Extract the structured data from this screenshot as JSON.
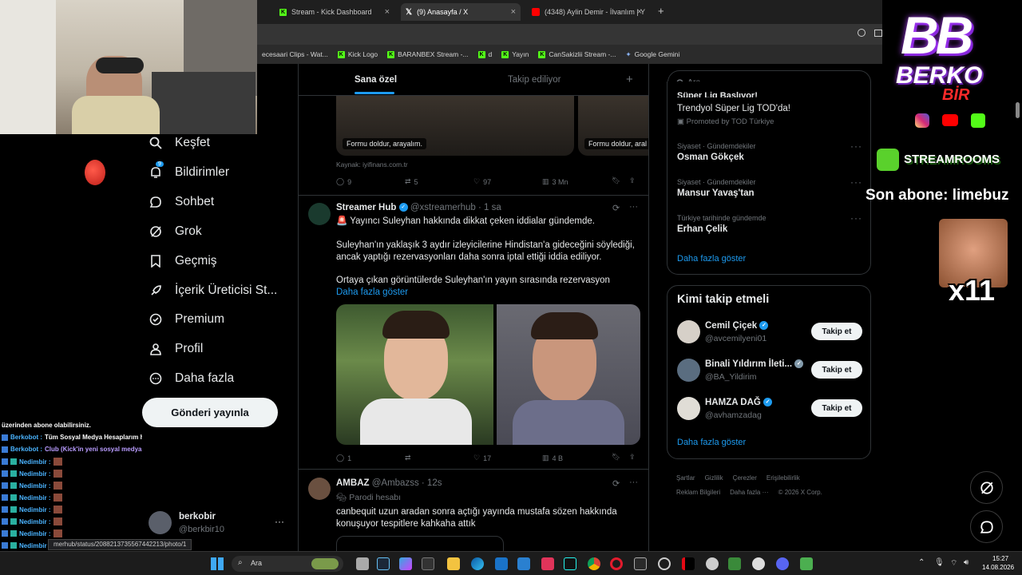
{
  "browser": {
    "tabs": [
      {
        "label": "Stream - Kick Dashboard",
        "close": "×"
      },
      {
        "label": "(9) Anasayfa / X",
        "close": "×"
      },
      {
        "label": "(4348) Aylin Demir - İlvanlım | Y",
        "close": "×"
      }
    ],
    "new_tab": "+",
    "bookmarks": [
      "ecesaari Clips - Wat...",
      "Kick Logo",
      "BARANBEX Stream -...",
      "d",
      "Yayın",
      "CanSakizlii Stream -...",
      "Google Gemini"
    ],
    "kick_letter": "K"
  },
  "nav": {
    "items": [
      "Keşfet",
      "Bildirimler",
      "Sohbet",
      "Grok",
      "Geçmiş",
      "İçerik Üreticisi St...",
      "Premium",
      "Profil",
      "Daha fazla"
    ],
    "notif_count": "9",
    "post_button": "Gönderi yayınla",
    "user": {
      "name": "berkobir",
      "handle": "@berkbir10",
      "more": "···"
    }
  },
  "timeline": {
    "tabs": [
      "Sana özel",
      "Takip ediliyor"
    ],
    "add": "+",
    "tweet1": {
      "card_labels": [
        "Formu doldur, arayalım.",
        "Formu doldur, aral"
      ],
      "source": "Kaynak: iyifinans.com.tr",
      "stats": [
        "9",
        "5",
        "97",
        "3 Mn"
      ]
    },
    "tweet2": {
      "name": "Streamer Hub",
      "handle": "@xstreamerhub · 1 sa",
      "line1": "🚨 Yayıncı Suleyhan hakkında dikkat çeken iddialar gündemde.",
      "line2": "Suleyhan'ın yaklaşık 3 aydır izleyicilerine Hindistan'a gideceğini söylediği, ancak yaptığı rezervasyonları daha sonra iptal ettiği iddia ediliyor.",
      "line3": "Ortaya çıkan görüntülerde Suleyhan'ın yayın sırasında rezervasyon",
      "more": "Daha fazla göster",
      "stats": [
        "1",
        "",
        "17",
        "4 B"
      ]
    },
    "tweet3": {
      "name": "AMBAZ",
      "handle": "@Ambazss · 12s",
      "parody": "Parodi hesabı",
      "text": "canbequit uzun aradan sonra açtığı yayında mustafa sözen hakkında konuşuyor tespitlere kahkaha attık"
    }
  },
  "sidebar": {
    "search_placeholder": "Ara",
    "trends_partial": "Süper Lig Başlıyor!",
    "promo": {
      "title": "Trendyol Süper Lig TOD'da!",
      "by": "Promoted by TOD Türkiye"
    },
    "trends": [
      {
        "cat": "Siyaset · Gündemdekiler",
        "name": "Osman Gökçek"
      },
      {
        "cat": "Siyaset · Gündemdekiler",
        "name": "Mansur Yavaş'tan"
      },
      {
        "cat": "Türkiye tarihinde gündemde",
        "name": "Erhan Çelik"
      }
    ],
    "show_more": "Daha fazla göster",
    "who_to_follow": {
      "title": "Kimi takip etmeli",
      "users": [
        {
          "name": "Cemil Çiçek",
          "handle": "@avcemilyeni01"
        },
        {
          "name": "Binali Yıldırım İleti...",
          "handle": "@BA_Yildirim"
        },
        {
          "name": "HAMZA DAĞ",
          "handle": "@avhamzadag"
        }
      ],
      "follow_label": "Takip et",
      "show_more": "Daha fazla göster"
    },
    "footer": [
      "Şartlar",
      "Gizlilik",
      "Çerezler",
      "Erişilebilirlik",
      "Reklam Bilgileri",
      "Daha fazla ···",
      "© 2026 X Corp."
    ]
  },
  "chat": {
    "lines": [
      {
        "user": "",
        "text": "üzerinden abone olabilirsiniz."
      },
      {
        "user": "Berkobot :",
        "text": "Tüm Sosyal Medya Hesaplarım https://linktr.ee/Berkobir"
      },
      {
        "user": "Berkobot :",
        "text": "Club (Kick'in yeni sosyal medya uygulaması) https://club.com/berkobir"
      },
      {
        "user": "Nedimbir :",
        "text": ""
      },
      {
        "user": "Nedimbir :",
        "text": ""
      },
      {
        "user": "Nedimbir :",
        "text": ""
      },
      {
        "user": "Nedimbir :",
        "text": ""
      },
      {
        "user": "Nedimbir :",
        "text": ""
      },
      {
        "user": "Nedimbir :",
        "text": ""
      },
      {
        "user": "Nedimbir :",
        "text": ""
      },
      {
        "user": "Nedimbir :",
        "text": ""
      },
      {
        "user": "Nedimbir :",
        "text": ""
      }
    ]
  },
  "status_url": "merhub/status/2088213735567442213/photo/1",
  "overlay": {
    "logo_top": "BB",
    "logo_name": "BERKO",
    "logo_sub": "BİR",
    "streamrooms": "STREAMROOMS",
    "sub_text": "Son abone: limebuz",
    "multiplier": "x11"
  },
  "taskbar": {
    "search": "Ara",
    "time": "15:27",
    "date": "14.08.2026"
  }
}
